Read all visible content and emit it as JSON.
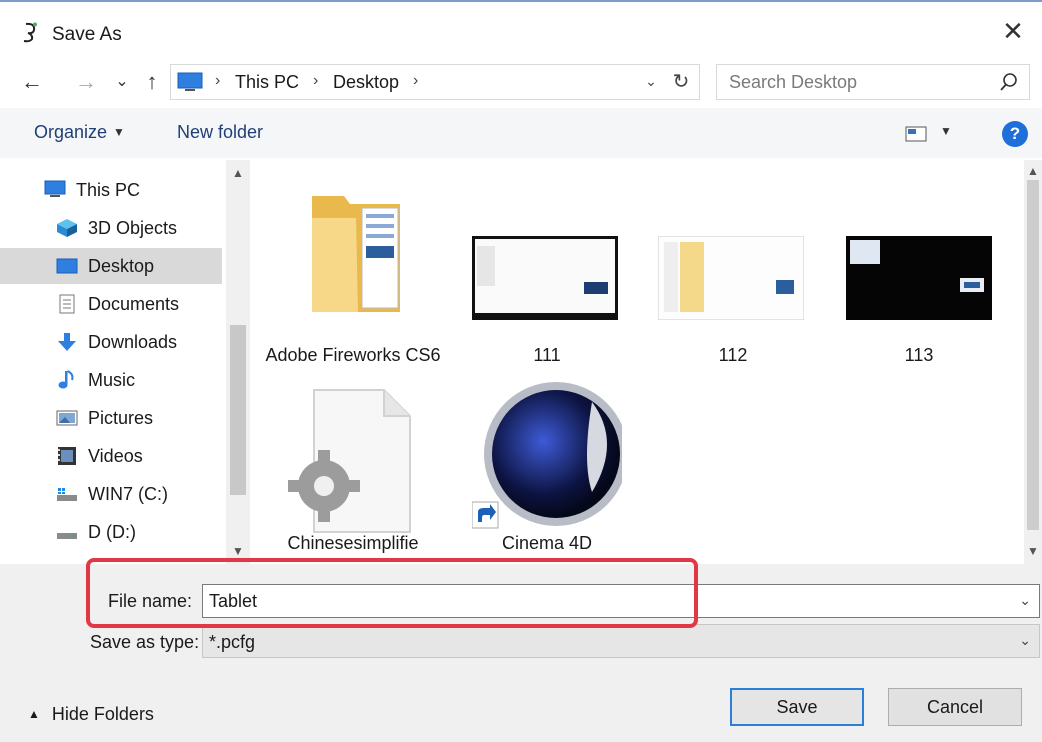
{
  "window": {
    "title": "Save As",
    "close_glyph": "✕"
  },
  "nav": {
    "back_glyph": "←",
    "forward_glyph": "→",
    "recent_glyph": "⌄",
    "up_glyph": "↑"
  },
  "address": {
    "crumbs": [
      "This PC",
      "Desktop"
    ],
    "separator": "›",
    "dropdown_glyph": "⌄",
    "refresh_glyph": "↻"
  },
  "search": {
    "placeholder": "Search Desktop"
  },
  "toolbar": {
    "organize_label": "Organize",
    "new_folder_label": "New folder",
    "help_label": "?"
  },
  "sidebar": {
    "items": [
      {
        "label": "This PC",
        "icon": "computer-icon"
      },
      {
        "label": "3D Objects",
        "icon": "3d-objects-icon"
      },
      {
        "label": "Desktop",
        "icon": "desktop-icon",
        "selected": true
      },
      {
        "label": "Documents",
        "icon": "documents-icon"
      },
      {
        "label": "Downloads",
        "icon": "downloads-icon"
      },
      {
        "label": "Music",
        "icon": "music-icon"
      },
      {
        "label": "Pictures",
        "icon": "pictures-icon"
      },
      {
        "label": "Videos",
        "icon": "videos-icon"
      },
      {
        "label": "WIN7 (C:)",
        "icon": "drive-c-icon"
      },
      {
        "label": "D (D:)",
        "icon": "drive-d-icon"
      }
    ]
  },
  "files": {
    "items": [
      {
        "name": "Adobe Fireworks CS6",
        "type": "folder"
      },
      {
        "name": "111",
        "type": "screenshot"
      },
      {
        "name": "112",
        "type": "screenshot"
      },
      {
        "name": "113",
        "type": "screenshot"
      },
      {
        "name": "Chinesesimplifie",
        "type": "settings-file"
      },
      {
        "name": "Cinema 4D",
        "type": "shortcut"
      }
    ]
  },
  "save_form": {
    "file_name_label": "File name:",
    "file_name_value": "Tablet",
    "save_type_label": "Save as type:",
    "save_type_value": "*.pcfg"
  },
  "footer": {
    "hide_folders_label": "Hide Folders",
    "save_label": "Save",
    "cancel_label": "Cancel"
  },
  "colors": {
    "accent": "#2a7fd9",
    "highlight": "#e23845",
    "selected_bg": "#d9d9d9",
    "folder": "#f5d17a"
  }
}
